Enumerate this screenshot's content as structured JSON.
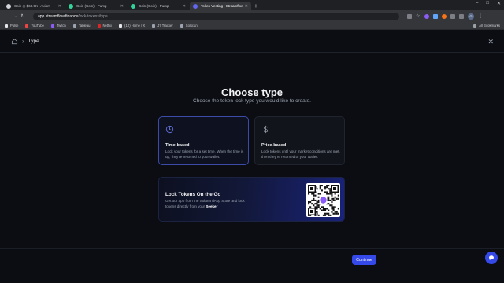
{
  "browser": {
    "tabs": [
      {
        "label": "Coin ◎ $68.9K | Axiom",
        "active": false,
        "favicon_color": "#d1d5db"
      },
      {
        "label": "Coin (Coin) - Pump",
        "active": false,
        "favicon_color": "#34d399"
      },
      {
        "label": "Coin (Coin) - Pump",
        "active": false,
        "favicon_color": "#34d399"
      },
      {
        "label": "Token Vesting | Streamflow",
        "active": true,
        "favicon_color": "#6366f1"
      }
    ],
    "new_tab_label": "+",
    "url_host": "app.streamflow.finance",
    "url_path": "/lock-tokens/type",
    "profile_initial": "G",
    "bookmarks": [
      {
        "label": "Pulse",
        "color": "#e5e7eb"
      },
      {
        "label": "YouTube",
        "color": "#ef4444"
      },
      {
        "label": "Twitch",
        "color": "#8b5cf6"
      },
      {
        "label": "Tableau",
        "color": "#9ca3af"
      },
      {
        "label": "Netflix",
        "color": "#dc2626"
      },
      {
        "label": "(10) Home / X",
        "color": "#e5e7eb"
      },
      {
        "label": "J7 Tracker",
        "color": "#9ca3af"
      },
      {
        "label": "Solscan",
        "color": "#9ca3af"
      }
    ],
    "all_bookmarks_label": "All Bookmarks"
  },
  "header": {
    "breadcrumb": "Type"
  },
  "main": {
    "title": "Choose type",
    "subtitle": "Choose the token lock type you would like to create.",
    "cards": [
      {
        "title": "Time-based",
        "description": "Lock your tokens for a set time. When the time is up, they're returned to your wallet.",
        "icon": "clock-icon",
        "selected": true
      },
      {
        "title": "Price-based",
        "description": "Lock tokens until your market conditions are met, then they're returned to your wallet.",
        "icon": "dollar-icon",
        "selected": false
      }
    ],
    "promo": {
      "title": "Lock Tokens On the Go",
      "description_prefix": "Get our app from the Solana dApp Store and lock tokens directly from your ",
      "description_bold": "Seeker"
    }
  },
  "footer": {
    "continue_label": "Continue"
  },
  "colors": {
    "accent": "#3548e8",
    "background": "#0b0d12",
    "selected_border": "#3c4aa8"
  }
}
